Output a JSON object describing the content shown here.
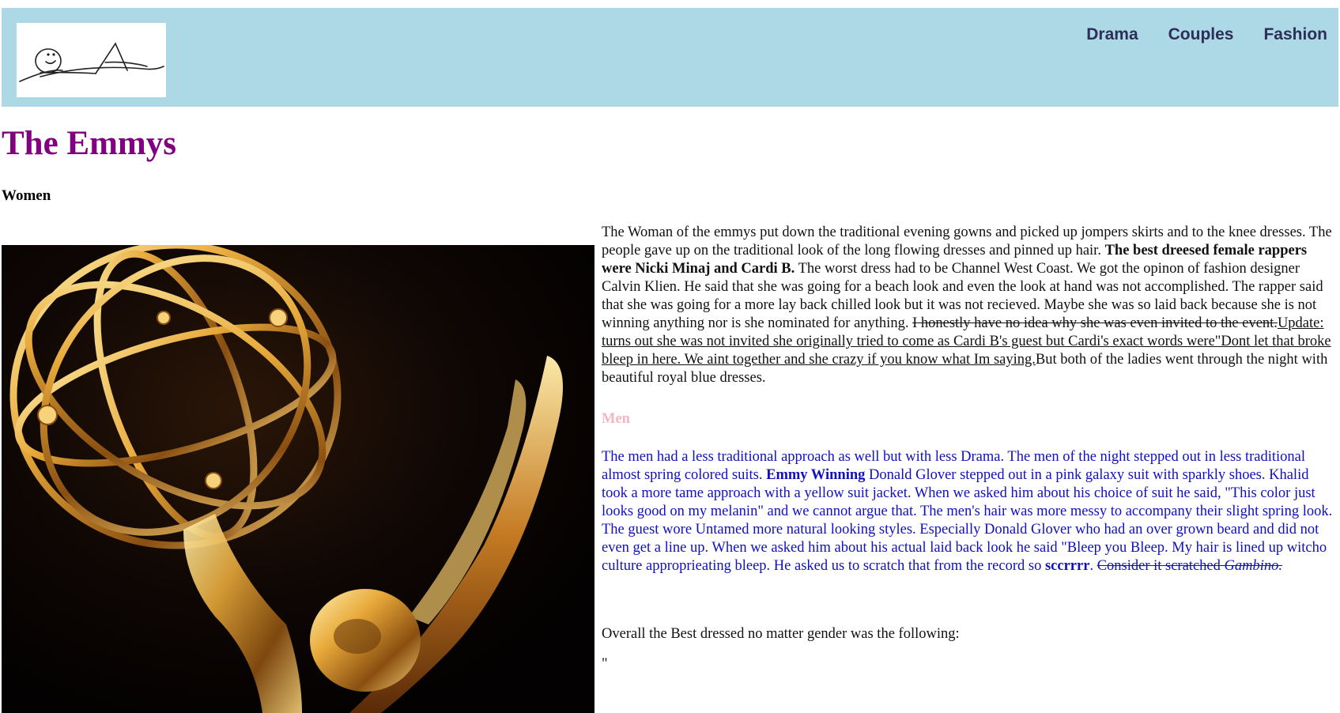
{
  "header": {
    "logo_alt": "signature logo",
    "nav": [
      {
        "label": "Drama"
      },
      {
        "label": "Couples"
      },
      {
        "label": "Fashion"
      }
    ]
  },
  "page": {
    "title": "The Emmys",
    "section_women": "Women"
  },
  "women": {
    "t1": "The Woman of the emmys put down the traditional evening gowns and picked up jompers skirts and to the knee dresses. The people gave up on the traditional look of the long flowing dresses and pinned up hair. ",
    "b1": "The best dreesed female rappers were Nicki Minaj and Cardi B.",
    "t2": " The worst dress had to be Channel West Coast. We got the opinon of fashion designer Calvin Klien. He said that she was going for a beach look and even the look at hand was not accomplished. The rapper said that she was going for a more lay back chilled look but it was not recieved. Maybe she was so laid back because she is not winning anything nor is she nominated for anything. ",
    "strike": "I honestly have no idea why she was even invited to the event.",
    "underline": "Update: turns out she was not invited she originally tried to come as Cardi B's guest but Cardi's exact words were\"Dont let that broke bleep in here. We aint together and she crazy if you know what Im saying.",
    "t3": "But both of the ladies went through the night with beautiful royal blue dresses."
  },
  "men": {
    "heading": "Men",
    "t1": "The men had a less traditional approach as well but with less Drama. The men of the night stepped out in less traditional almost spring colored suits. ",
    "b1": "Emmy Winning",
    "t2": " Donald Glover stepped out in a pink galaxy suit with sparkly shoes. Khalid took a more tame approach with a yellow suit jacket. When we asked him about his choice of suit he said, \"This color just looks good on my melanin\" and we cannot argue that. The men's hair was more messy to accompany their slight spring look. The guest wore Untamed more natural looking styles. Especially Donald Glover who had an over grown beard and did not even get a line up. When we asked him about his actual laid back look he said \"Bleep you Bleep. My hair is lined up witcho culture approprieating bleep. He asked us to scratch that from the record so ",
    "b2": "sccrrrr",
    "t3": ". ",
    "strike": "Consider it scratched ",
    "strike_italic": "Gambino."
  },
  "overall": {
    "text": "Overall the Best dressed no matter gender was the following:",
    "quote": "\""
  },
  "colors": {
    "header_bg": "#add8e6",
    "title": "#800080",
    "men_heading": "#f4b6c2",
    "men_text": "#1010c0",
    "nav_text": "#2b2f5a"
  }
}
